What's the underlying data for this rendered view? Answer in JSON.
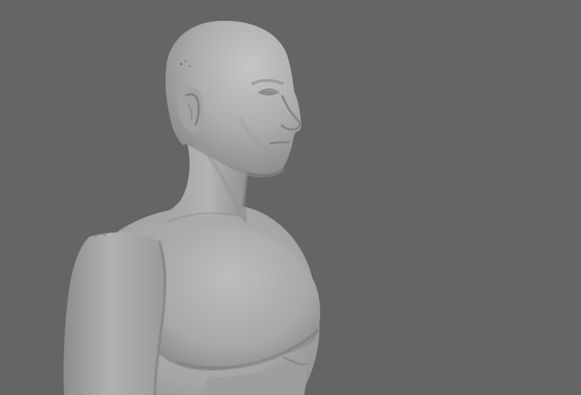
{
  "viewport": {
    "background_color": "#656565",
    "subject": "clay-render-male-bust",
    "clay_color": "#a7a7a7",
    "clay_highlight": "#c4c4c4",
    "clay_shadow": "#7b7b7b"
  }
}
